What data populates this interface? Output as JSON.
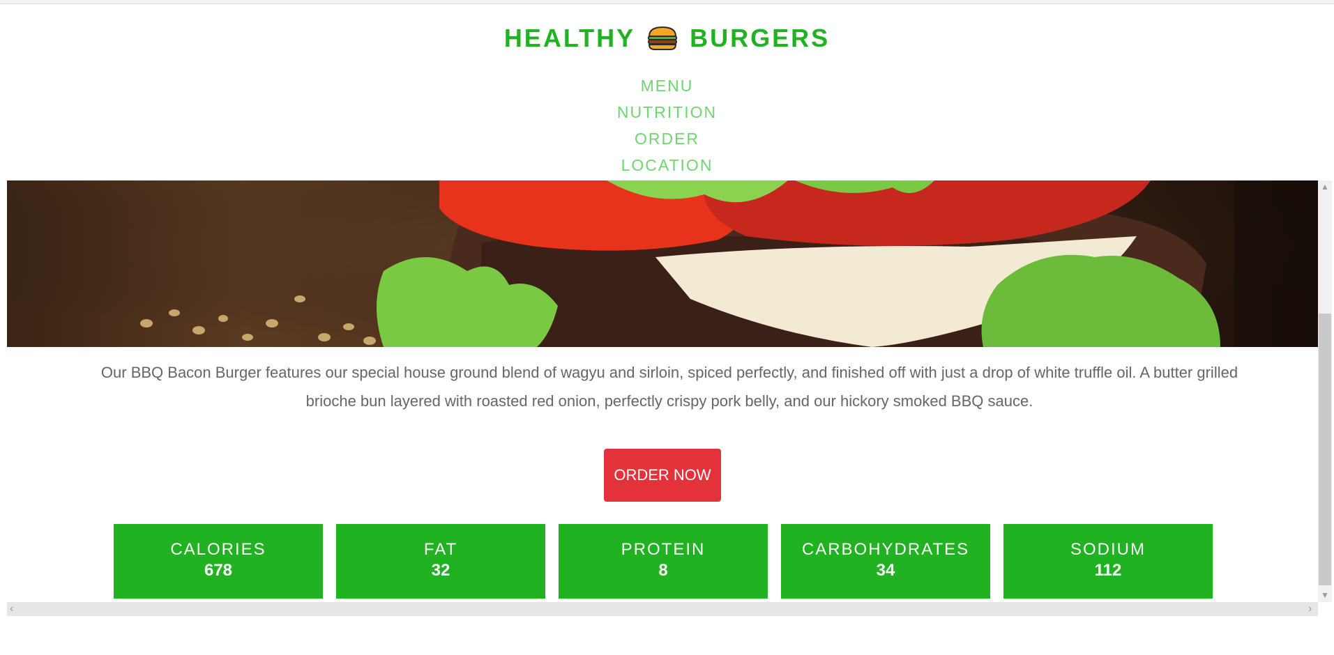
{
  "header": {
    "title_left": "HEALTHY",
    "title_right": "BURGERS",
    "icon": "burger-icon"
  },
  "nav": {
    "items": [
      {
        "label": "MENU"
      },
      {
        "label": "NUTRITION"
      },
      {
        "label": "ORDER"
      },
      {
        "label": "LOCATION"
      }
    ]
  },
  "hero": {
    "image": "bbq-bacon-burger-photo"
  },
  "description": "Our BBQ Bacon Burger features our special house ground blend of wagyu and sirloin, spiced perfectly, and finished off with just a drop of white truffle oil. A butter grilled brioche bun layered with roasted red onion, perfectly crispy pork belly, and our hickory smoked BBQ sauce.",
  "order_button": {
    "label": "ORDER NOW"
  },
  "nutrition": [
    {
      "label": "CALORIES",
      "value": "678"
    },
    {
      "label": "FAT",
      "value": "32"
    },
    {
      "label": "PROTEIN",
      "value": "8"
    },
    {
      "label": "CARBOHYDRATES",
      "value": "34"
    },
    {
      "label": "SODIUM",
      "value": "112"
    }
  ],
  "colors": {
    "brand_green": "#21b221",
    "nav_green": "#6fd66f",
    "order_red": "#e3323a",
    "text_gray": "#666666"
  },
  "icons": {
    "scroll_up": "chevron-up-icon",
    "scroll_down": "chevron-down-icon",
    "scroll_left": "chevron-left-icon",
    "scroll_right": "chevron-right-icon"
  }
}
